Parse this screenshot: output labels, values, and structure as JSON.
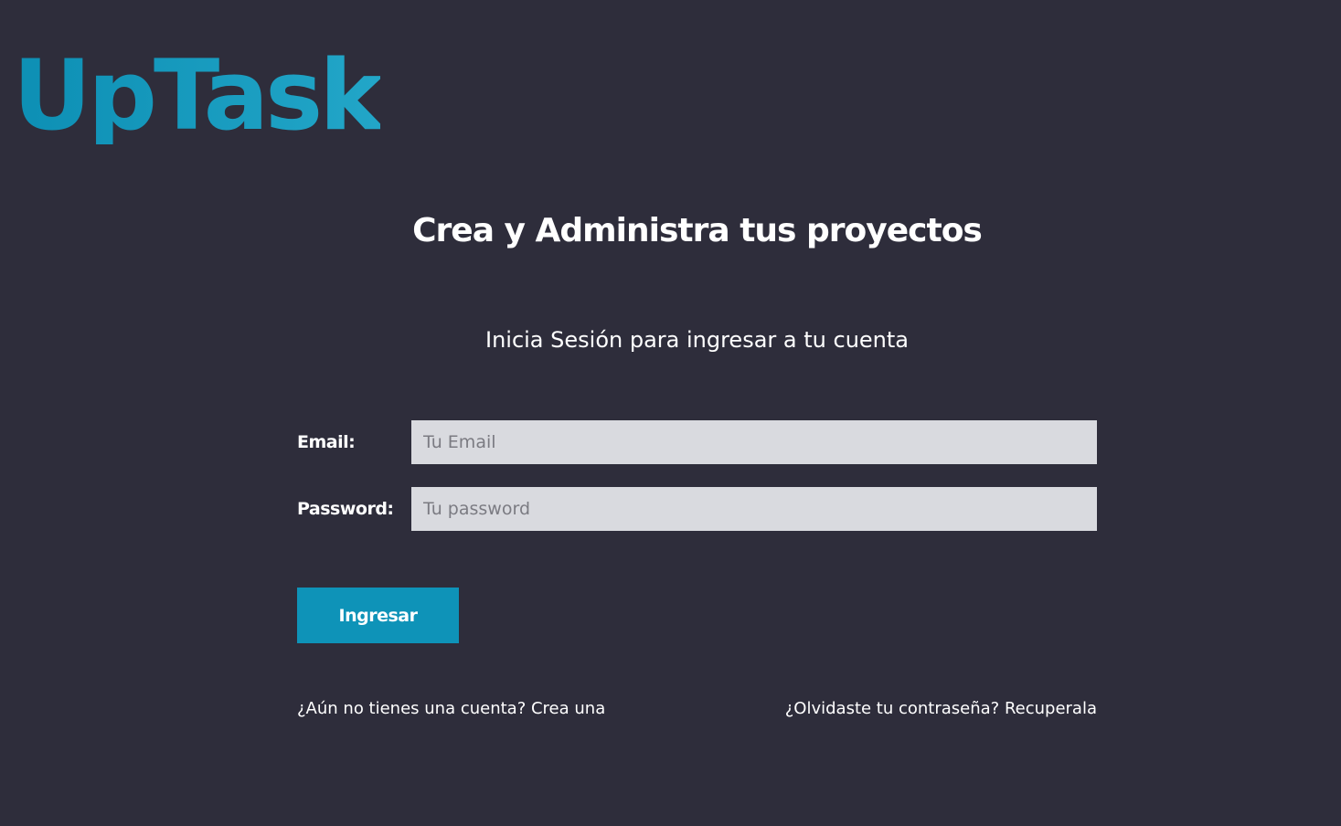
{
  "app": {
    "logo": "UpTask",
    "tagline": "Crea y Administra tus proyectos"
  },
  "login": {
    "subtitle": "Inicia Sesión para ingresar a tu cuenta",
    "email": {
      "label": "Email:",
      "value": "",
      "placeholder": "Tu Email"
    },
    "password": {
      "label": "Password:",
      "value": "",
      "placeholder": "Tu password"
    },
    "submit_label": "Ingresar",
    "links": {
      "create_account": "¿Aún no tienes una cuenta? Crea una",
      "forgot_password": "¿Olvidaste tu contraseña? Recuperala"
    }
  },
  "colors": {
    "background": "#2e2d3b",
    "accent": "#0e93b8",
    "input_background": "#d9dadf",
    "text": "#ffffff"
  }
}
